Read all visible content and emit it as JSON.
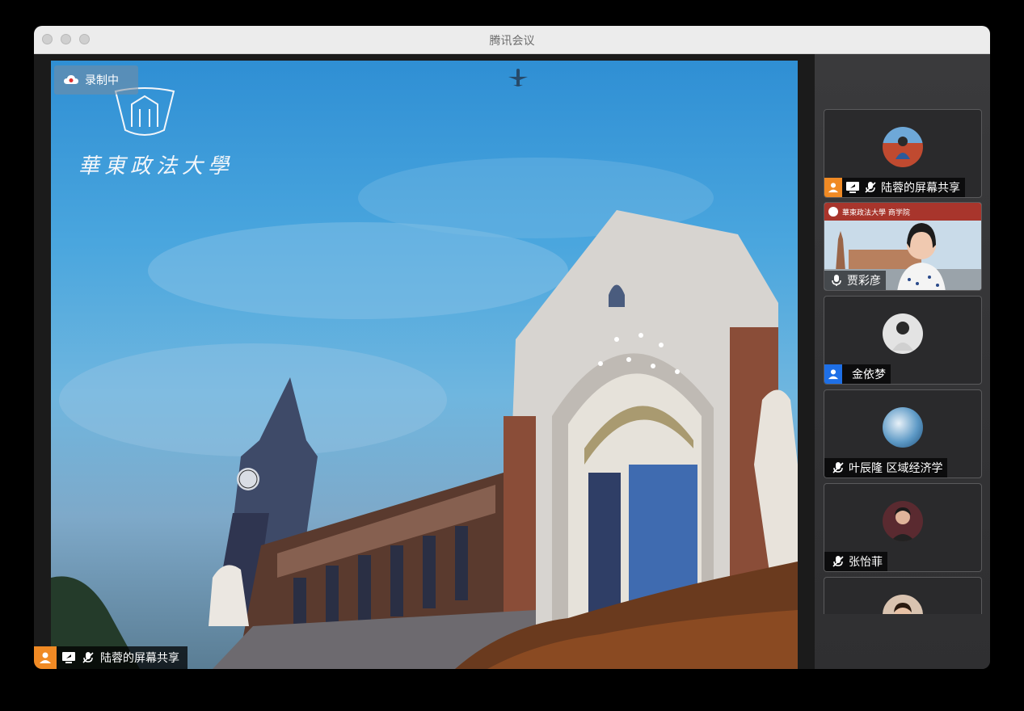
{
  "window": {
    "title": "腾讯会议"
  },
  "share": {
    "recording_label": "录制中",
    "university_name": "華東政法大學"
  },
  "bottom_bar": {
    "label": "陆蓉的屏幕共享"
  },
  "participants": [
    {
      "label": "陆蓉的屏幕共享",
      "type": "share"
    },
    {
      "label": "贾彩彦",
      "type": "video",
      "banner": "華東政法大學 商学院"
    },
    {
      "label": "金依梦",
      "type": "avatar"
    },
    {
      "label": "叶辰隆 区域经济学",
      "type": "avatar"
    },
    {
      "label": "张怡菲",
      "type": "avatar"
    },
    {
      "label": "",
      "type": "avatar"
    }
  ],
  "colors": {
    "accent_orange": "#f08a24",
    "accent_blue": "#1e6fe6"
  }
}
